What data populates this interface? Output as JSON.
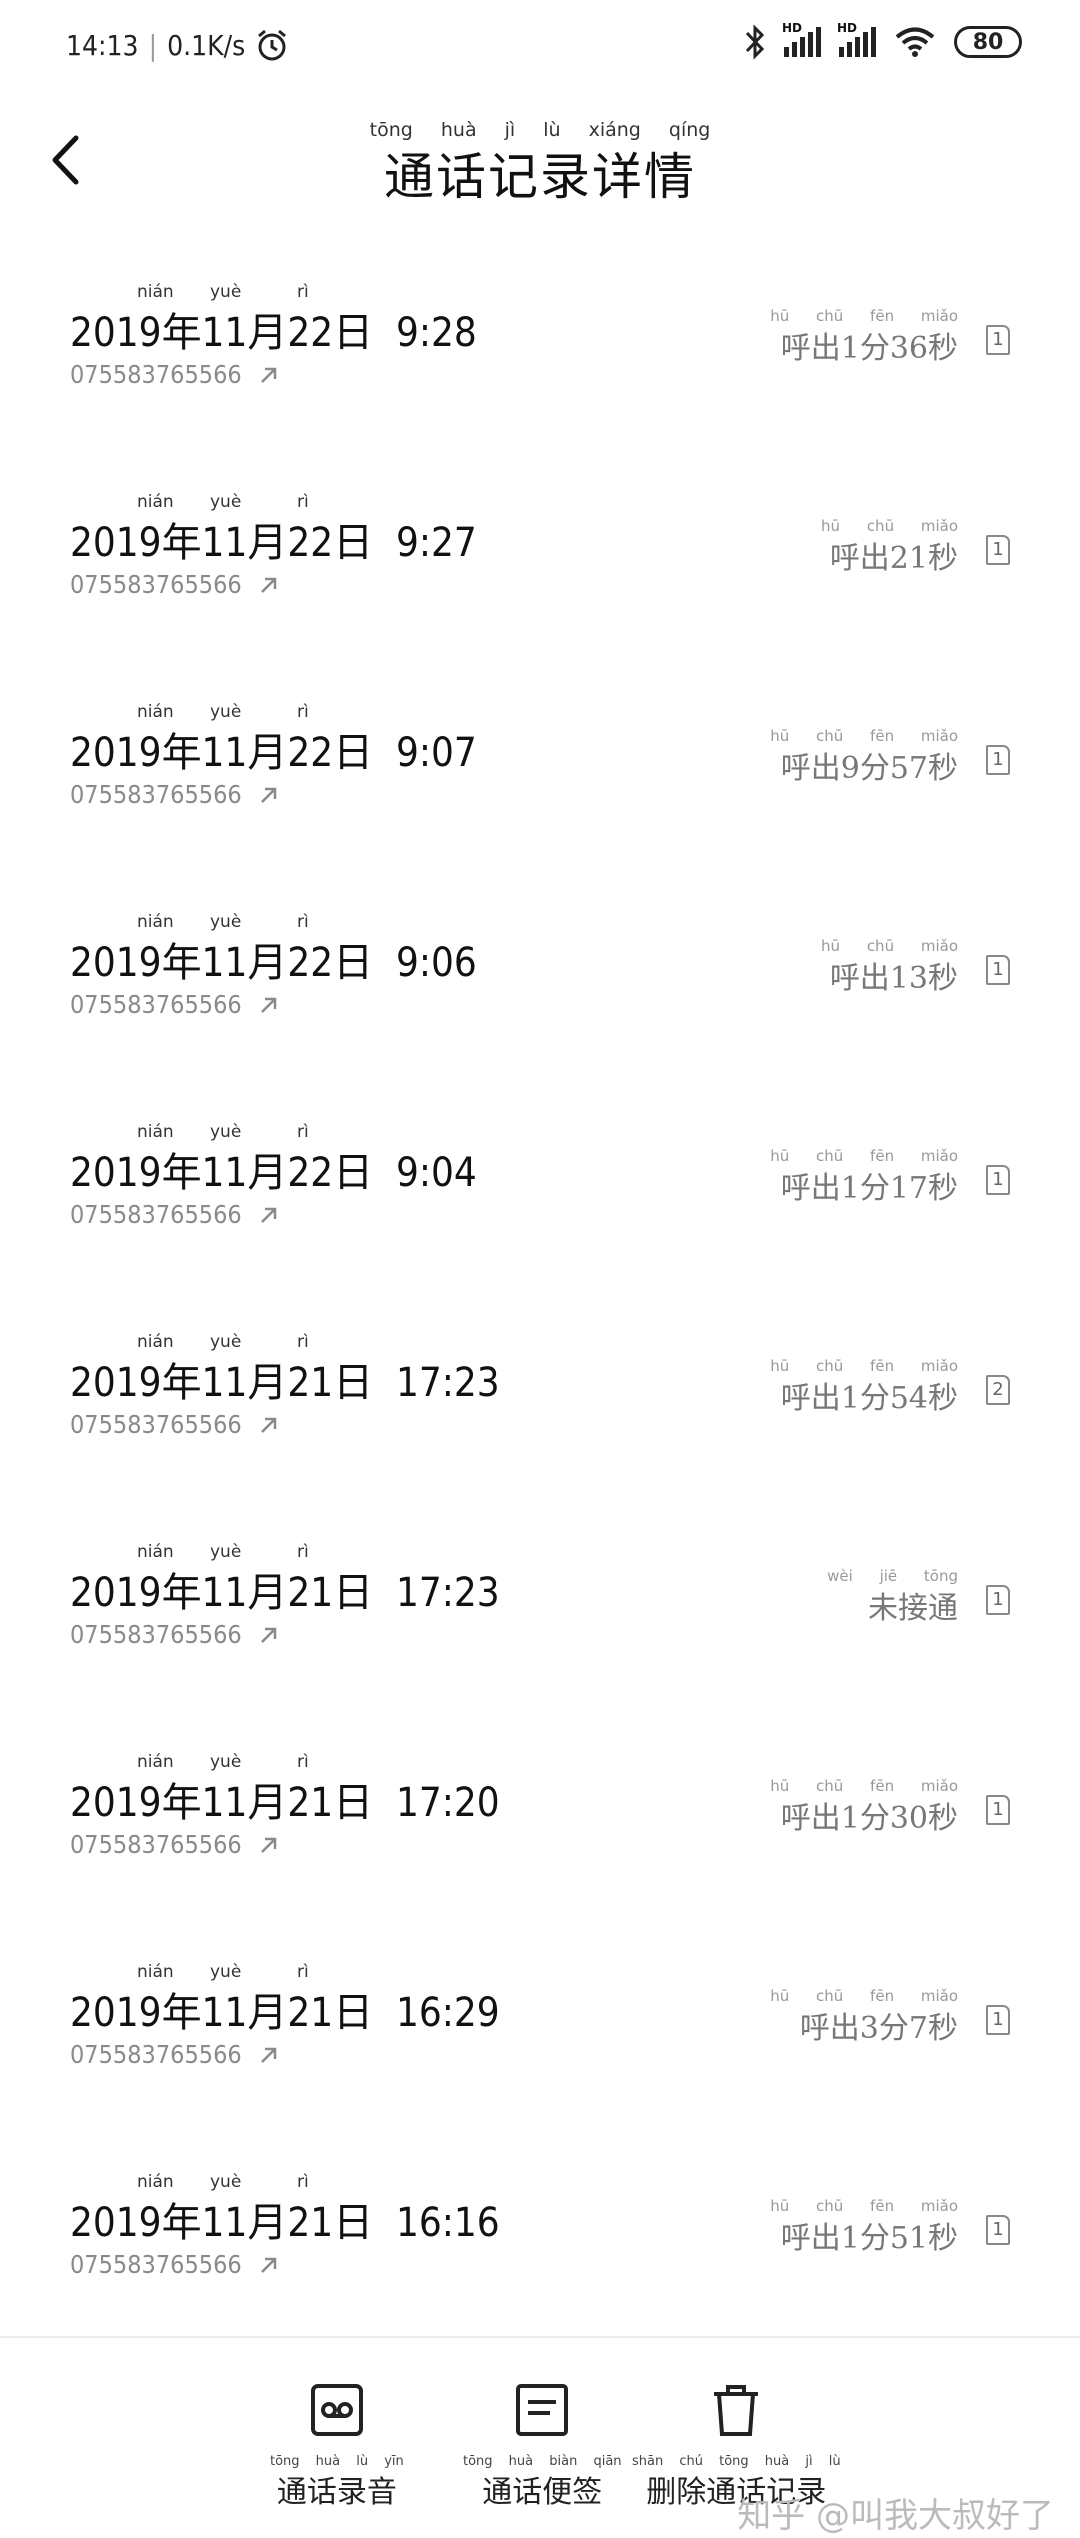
{
  "status_bar": {
    "time": "14:13",
    "net_speed": "0.1K/s",
    "battery": "80",
    "signal_badge": "HD"
  },
  "header": {
    "title": "通话记录详情",
    "title_pinyin": "tōng huà jì lù xiáng qíng"
  },
  "date_pinyin": {
    "nian": "nián",
    "yue": "yuè",
    "ri": "rì"
  },
  "records": [
    {
      "datetime": "2019年11月22日  9:28",
      "number": "075583765566",
      "duration": "呼出1分36秒",
      "duration_pinyin": "hū chū fēn miǎo",
      "sim": "1"
    },
    {
      "datetime": "2019年11月22日  9:27",
      "number": "075583765566",
      "duration": "呼出21秒",
      "duration_pinyin": "hū chū miǎo",
      "sim": "1"
    },
    {
      "datetime": "2019年11月22日  9:07",
      "number": "075583765566",
      "duration": "呼出9分57秒",
      "duration_pinyin": "hū chū fēn miǎo",
      "sim": "1"
    },
    {
      "datetime": "2019年11月22日  9:06",
      "number": "075583765566",
      "duration": "呼出13秒",
      "duration_pinyin": "hū chū miǎo",
      "sim": "1"
    },
    {
      "datetime": "2019年11月22日  9:04",
      "number": "075583765566",
      "duration": "呼出1分17秒",
      "duration_pinyin": "hū chū fēn miǎo",
      "sim": "1"
    },
    {
      "datetime": "2019年11月21日  17:23",
      "number": "075583765566",
      "duration": "呼出1分54秒",
      "duration_pinyin": "hū chū fēn miǎo",
      "sim": "2"
    },
    {
      "datetime": "2019年11月21日  17:23",
      "number": "075583765566",
      "duration": "未接通",
      "duration_pinyin": "wèi jiē tōng",
      "sim": "1"
    },
    {
      "datetime": "2019年11月21日  17:20",
      "number": "075583765566",
      "duration": "呼出1分30秒",
      "duration_pinyin": "hū chū fēn miǎo",
      "sim": "1"
    },
    {
      "datetime": "2019年11月21日  16:29",
      "number": "075583765566",
      "duration": "呼出3分7秒",
      "duration_pinyin": "hū chū fēn miǎo",
      "sim": "1"
    },
    {
      "datetime": "2019年11月21日  16:16",
      "number": "075583765566",
      "duration": "呼出1分51秒",
      "duration_pinyin": "hū chū fēn miǎo",
      "sim": "1"
    }
  ],
  "bottom_actions": {
    "record": {
      "label": "通话录音",
      "pinyin": "tōng huà lù yīn"
    },
    "notes": {
      "label": "通话便签",
      "pinyin": "tōng huà biàn qiān"
    },
    "delete": {
      "label": "删除通话记录",
      "pinyin": "shān chú tōng huà jì lù"
    }
  },
  "watermark": "知乎 @叫我大叔好了",
  "icons": {
    "back": "chevron-left-icon",
    "bluetooth": "bluetooth-icon",
    "wifi": "wifi-icon",
    "alarm": "alarm-clock-icon",
    "recording": "voicemail-tape-icon",
    "notes": "note-icon",
    "delete": "trash-icon",
    "call_back": "arrow-up-right-icon",
    "sim": "sim-card-icon"
  }
}
